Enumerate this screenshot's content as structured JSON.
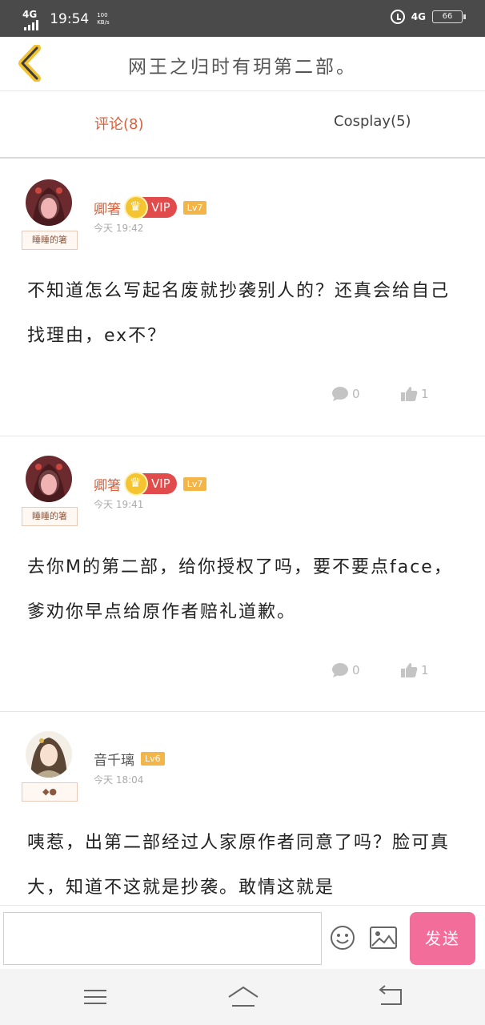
{
  "status_bar": {
    "network_left": "4G",
    "time": "19:54",
    "speed": "100\nKB/s",
    "network_right": "4G",
    "battery": "66"
  },
  "header": {
    "title": "网王之归时有玥第二部。"
  },
  "tabs": [
    {
      "label": "评论(8)",
      "active": true
    },
    {
      "label": "Cosplay(5)",
      "active": false
    }
  ],
  "comments": [
    {
      "username": "卿箸",
      "vip": "VIP",
      "level": "Lv7",
      "time": "今天 19:42",
      "badge": "睡睡的箸",
      "text": "不知道怎么写起名废就抄袭别人的？还真会给自己找理由，ex不？",
      "replies": "0",
      "likes": "1"
    },
    {
      "username": "卿箸",
      "vip": "VIP",
      "level": "Lv7",
      "time": "今天 19:41",
      "badge": "睡睡的箸",
      "text": "去你M的第二部，给你授权了吗，要不要点face，爹劝你早点给原作者赔礼道歉。",
      "replies": "0",
      "likes": "1"
    },
    {
      "username": "音千璃",
      "level": "Lv6",
      "time": "今天 18:04",
      "badge": "◆●",
      "text": "咦惹，出第二部经过人家原作者同意了吗？脸可真大，知道不这就是抄袭。敢情这就是"
    }
  ],
  "input_bar": {
    "placeholder": "",
    "send_label": "发送"
  },
  "colors": {
    "accent": "#d9603b",
    "send": "#f36d9a",
    "vip": "#e24b4b",
    "level": "#f4b548"
  }
}
